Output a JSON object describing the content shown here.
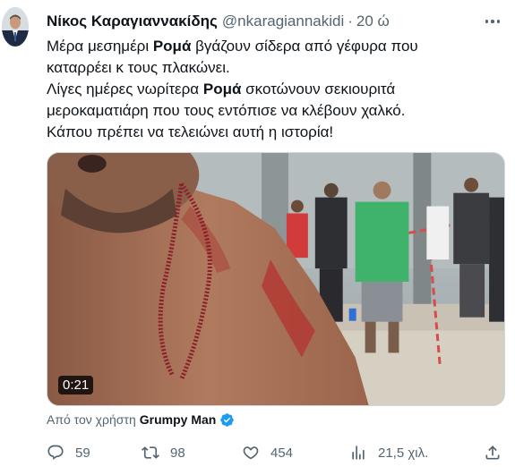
{
  "tweet": {
    "author_name": "Νίκος Καραγιαννακίδης",
    "author_handle": "@nkaragiannakidi",
    "separator": "·",
    "time": "20 ώ",
    "lines": [
      [
        "Μέρα μεσημέρι ",
        "Ρομά",
        " βγάζουν σίδερα από γέφυρα που"
      ],
      [
        "καταρρέει κ τους πλακώνει."
      ],
      [
        "Λίγες ημέρες νωρίτερα ",
        "Ρομά",
        " σκοτώνουν σεκιουριτά"
      ],
      [
        "μεροκαματιάρη που τους εντόπισε να κλέβουν χαλκό."
      ],
      [
        "Κάπου πρέπει να τελειώνει αυτή η ιστορία!"
      ]
    ]
  },
  "media": {
    "duration": "0:21"
  },
  "attribution": {
    "prefix": "Από τον χρήστη",
    "user": "Grumpy Man"
  },
  "actions": {
    "reply_count": "59",
    "retweet_count": "98",
    "like_count": "454",
    "views_count": "21,5 χιλ."
  },
  "icons": {
    "more": "more-options-icon",
    "verified": "verified-badge-icon",
    "reply": "reply-icon",
    "retweet": "retweet-icon",
    "like": "heart-icon",
    "views": "views-chart-icon",
    "share": "share-icon"
  },
  "colors": {
    "text": "#0f1419",
    "secondary": "#536471",
    "verified": "#1d9bf0",
    "border": "#cfd9de"
  }
}
